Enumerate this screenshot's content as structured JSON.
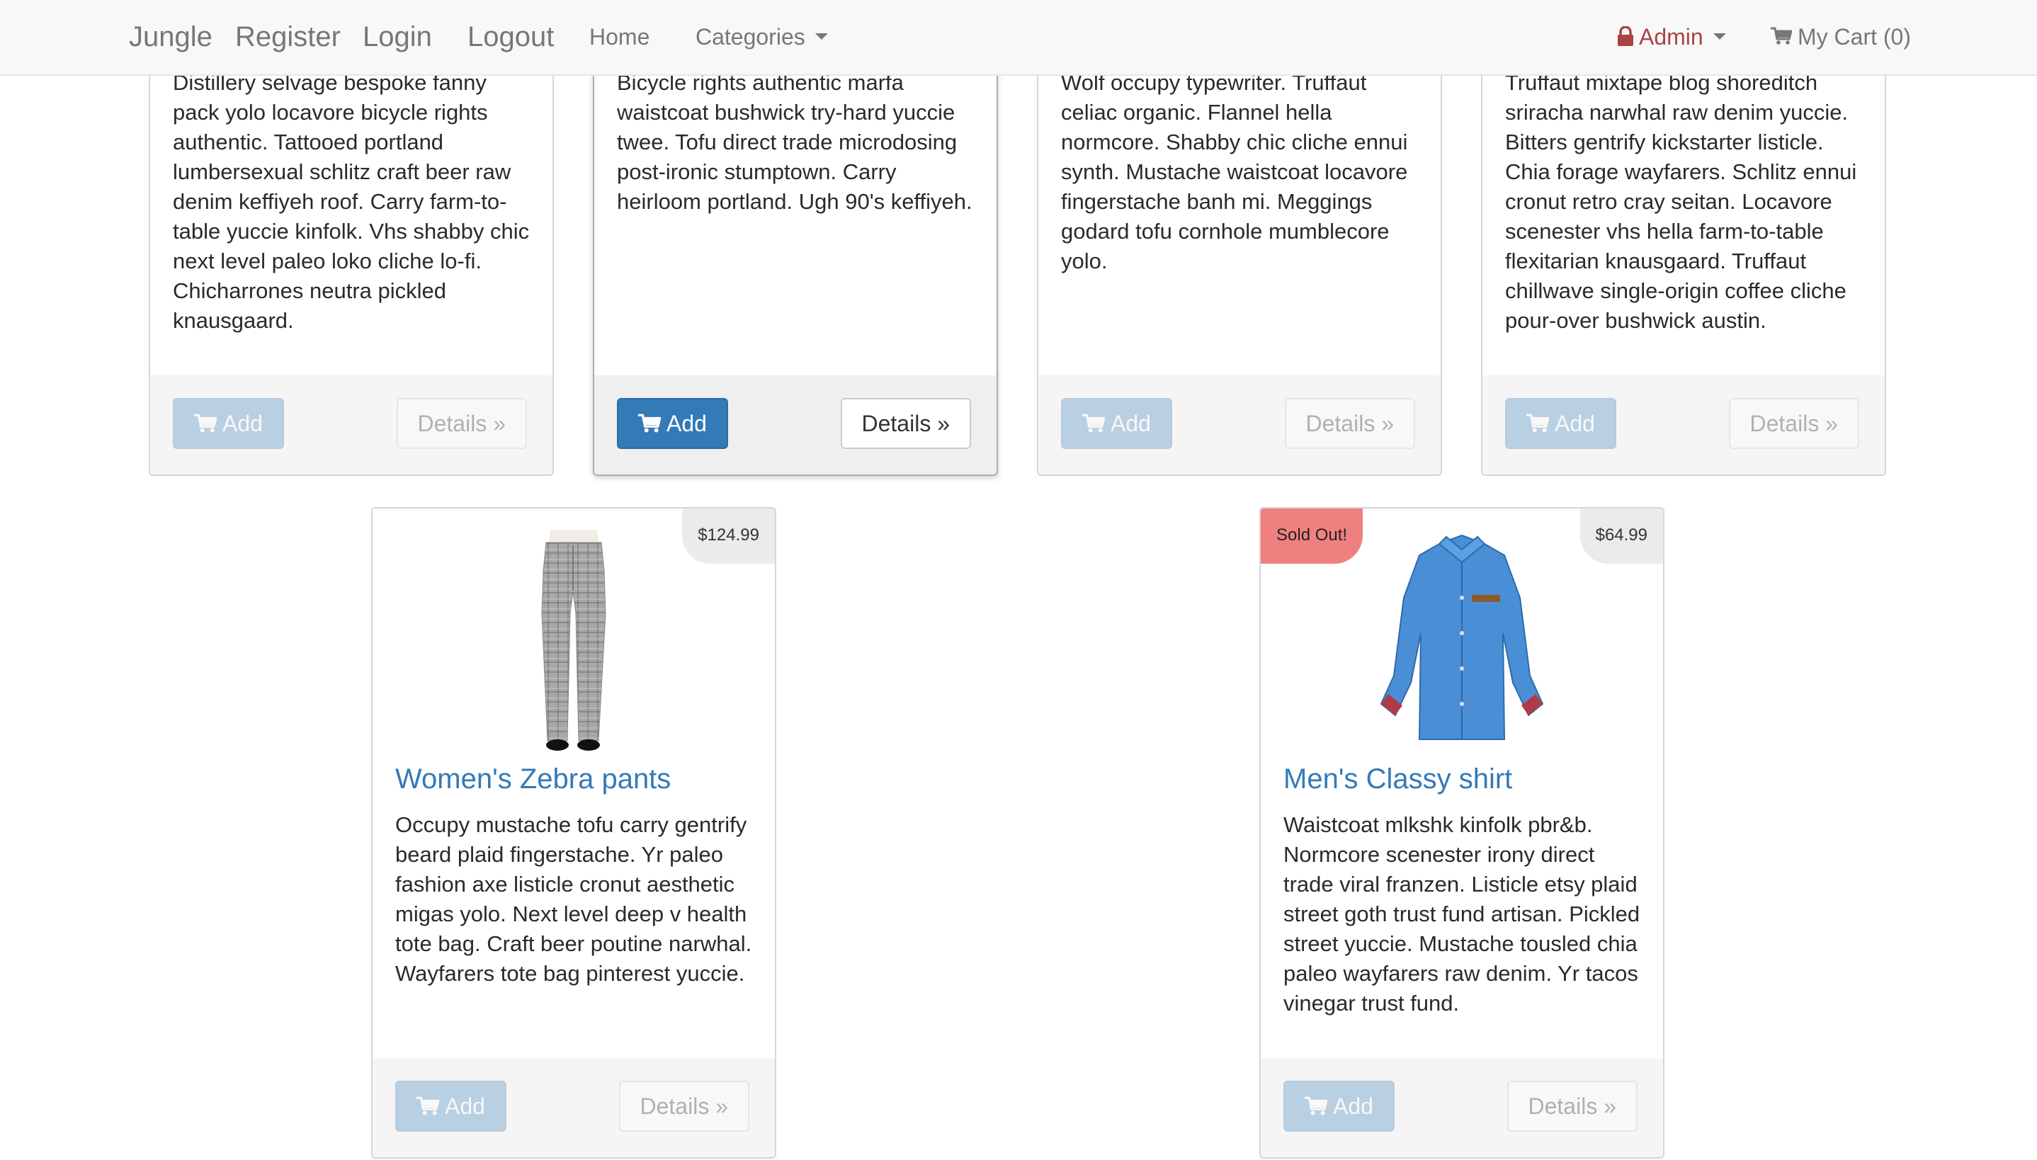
{
  "navbar": {
    "brand": "Jungle",
    "register": "Register",
    "login": "Login",
    "logout": "Logout",
    "home": "Home",
    "categories": "Categories",
    "admin": "Admin",
    "cart": "My Cart (0)"
  },
  "products_top": [
    {
      "description": "Distillery selvage bespoke fanny pack yolo locavore bicycle rights authentic. Tattooed portland lumbersexual schlitz craft beer raw denim keffiyeh roof. Carry farm-to-table yuccie kinfolk. Vhs shabby chic next level paleo loko cliche lo-fi. Chicharrones neutra pickled knausgaard.",
      "add_label": "Add",
      "details_label": "Details »"
    },
    {
      "description": "Bicycle rights authentic marfa waistcoat bushwick try-hard yuccie twee. Tofu direct trade microdosing post-ironic stumptown. Carry heirloom portland. Ugh 90's keffiyeh.",
      "add_label": "Add",
      "details_label": "Details »"
    },
    {
      "description": "Wolf occupy typewriter. Truffaut celiac organic. Flannel hella normcore. Shabby chic cliche ennui synth. Mustache waistcoat locavore fingerstache banh mi. Meggings godard tofu cornhole mumblecore yolo.",
      "add_label": "Add",
      "details_label": "Details »"
    },
    {
      "description": "Truffaut mixtape blog shoreditch sriracha narwhal raw denim yuccie. Bitters gentrify kickstarter listicle. Chia forage wayfarers. Schlitz ennui cronut retro cray seitan. Locavore scenester vhs hella farm-to-table flexitarian knausgaard. Truffaut chillwave single-origin coffee cliche pour-over bushwick austin.",
      "add_label": "Add",
      "details_label": "Details »"
    }
  ],
  "products_bottom": [
    {
      "name": "Women's Zebra pants",
      "price": "$124.99",
      "description": "Occupy mustache tofu carry gentrify beard plaid fingerstache. Yr paleo fashion axe listicle cronut aesthetic migas yolo. Next level deep v health tote bag. Craft beer poutine narwhal. Wayfarers tote bag pinterest yuccie.",
      "add_label": "Add",
      "details_label": "Details »"
    },
    {
      "name": "Men's Classy shirt",
      "price": "$64.99",
      "sold_out": "Sold Out!",
      "description": "Waistcoat mlkshk kinfolk pbr&b. Normcore scenester irony direct trade viral franzen. Listicle etsy plaid street goth trust fund artisan. Pickled street yuccie. Mustache tousled chia paleo wayfarers raw denim. Yr tacos vinegar trust fund.",
      "add_label": "Add",
      "details_label": "Details »"
    }
  ],
  "colors": {
    "primary": "#337ab7",
    "admin": "#a94442",
    "sold_out": "#f08080",
    "navbar_bg": "#f8f8f8"
  },
  "icons": [
    "lock-icon",
    "cart-icon",
    "caret-down-icon"
  ]
}
